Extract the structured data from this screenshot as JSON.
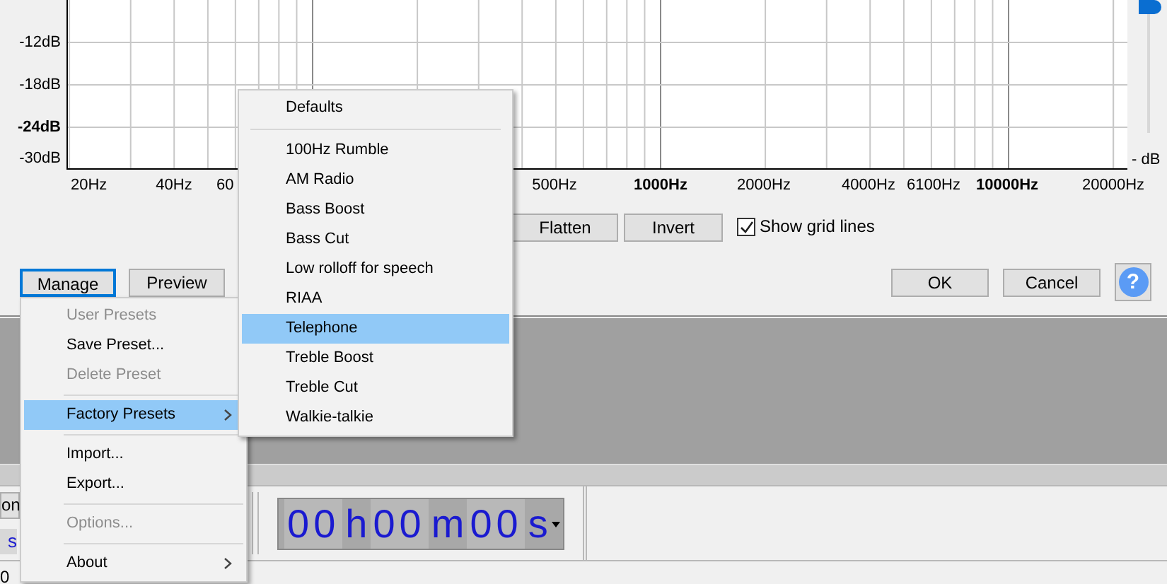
{
  "graph": {
    "y_labels": [
      "-12dB",
      "-18dB",
      "-24dB",
      "-30dB"
    ],
    "x_labels": [
      {
        "text": "20Hz",
        "bold": false
      },
      {
        "text": "40Hz",
        "bold": false
      },
      {
        "text": "60",
        "bold": false
      },
      {
        "text": "500Hz",
        "bold": false
      },
      {
        "text": "1000Hz",
        "bold": true
      },
      {
        "text": "2000Hz",
        "bold": false
      },
      {
        "text": "4000Hz",
        "bold": false
      },
      {
        "text": "6100Hz",
        "bold": false
      },
      {
        "text": "10000Hz",
        "bold": true
      },
      {
        "text": "20000Hz",
        "bold": false
      }
    ],
    "slider_label": "- dB"
  },
  "buttons": [
    {
      "label": "Flatten"
    },
    {
      "label": "Invert"
    }
  ],
  "show_grid_lines": {
    "label": "Show grid lines",
    "checked": true
  },
  "footer_buttons": [
    {
      "label": "Manage",
      "focused": true
    },
    {
      "label": "Preview",
      "focused": false
    }
  ],
  "dialog_buttons": [
    {
      "label": "OK"
    },
    {
      "label": "Cancel"
    },
    {
      "label": "?"
    }
  ],
  "manage_menu": [
    {
      "kind": "item",
      "label": "User Presets",
      "disabled": true,
      "selected": false,
      "submenu": false
    },
    {
      "kind": "item",
      "label": "Save Preset...",
      "disabled": false,
      "selected": false,
      "submenu": false
    },
    {
      "kind": "item",
      "label": "Delete Preset",
      "disabled": true,
      "selected": false,
      "submenu": false
    },
    {
      "kind": "separator"
    },
    {
      "kind": "item",
      "label": "Factory Presets",
      "disabled": false,
      "selected": true,
      "submenu": true
    },
    {
      "kind": "separator"
    },
    {
      "kind": "item",
      "label": "Import...",
      "disabled": false,
      "selected": false,
      "submenu": false
    },
    {
      "kind": "item",
      "label": "Export...",
      "disabled": false,
      "selected": false,
      "submenu": false
    },
    {
      "kind": "separator"
    },
    {
      "kind": "item",
      "label": "Options...",
      "disabled": true,
      "selected": false,
      "submenu": false
    },
    {
      "kind": "separator"
    },
    {
      "kind": "item",
      "label": "About",
      "disabled": false,
      "selected": false,
      "submenu": true
    }
  ],
  "factory_presets": [
    {
      "kind": "item",
      "label": "Defaults",
      "selected": false
    },
    {
      "kind": "separator"
    },
    {
      "kind": "item",
      "label": "100Hz Rumble",
      "selected": false
    },
    {
      "kind": "item",
      "label": "AM Radio",
      "selected": false
    },
    {
      "kind": "item",
      "label": "Bass Boost",
      "selected": false
    },
    {
      "kind": "item",
      "label": "Bass Cut",
      "selected": false
    },
    {
      "kind": "item",
      "label": "Low rolloff for speech",
      "selected": false
    },
    {
      "kind": "item",
      "label": "RIAA",
      "selected": false
    },
    {
      "kind": "item",
      "label": "Telephone",
      "selected": true
    },
    {
      "kind": "item",
      "label": "Treble Boost",
      "selected": false
    },
    {
      "kind": "item",
      "label": "Treble Cut",
      "selected": false
    },
    {
      "kind": "item",
      "label": "Walkie-talkie",
      "selected": false
    }
  ],
  "toolbar": {
    "left_button": "on",
    "left_readout": "s",
    "time": [
      "00",
      "h",
      "00",
      "m",
      "00",
      "s"
    ],
    "bottom_text": "0"
  }
}
